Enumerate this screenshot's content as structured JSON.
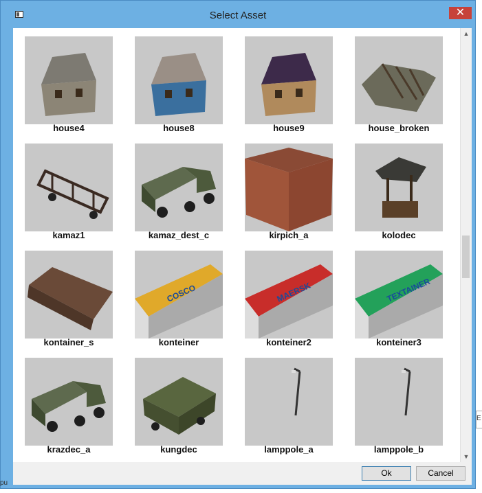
{
  "window": {
    "title": "Select Asset",
    "close_glyph": "✕"
  },
  "assets": [
    {
      "name": "house4",
      "icon": "house-icon"
    },
    {
      "name": "house8",
      "icon": "house-icon"
    },
    {
      "name": "house9",
      "icon": "house-icon"
    },
    {
      "name": "house_broken",
      "icon": "ruined-house-icon"
    },
    {
      "name": "kamaz1",
      "icon": "truck-frame-icon"
    },
    {
      "name": "kamaz_dest_c",
      "icon": "truck-icon"
    },
    {
      "name": "kirpich_a",
      "icon": "brick-cube-icon"
    },
    {
      "name": "kolodec",
      "icon": "well-icon"
    },
    {
      "name": "kontainer_s",
      "icon": "tank-container-icon"
    },
    {
      "name": "konteiner",
      "icon": "shipping-container-icon"
    },
    {
      "name": "konteiner2",
      "icon": "shipping-container-icon"
    },
    {
      "name": "konteiner3",
      "icon": "shipping-container-icon"
    },
    {
      "name": "krazdec_a",
      "icon": "truck-icon"
    },
    {
      "name": "kungdec",
      "icon": "truck-body-icon"
    },
    {
      "name": "lamppole_a",
      "icon": "lamppole-icon"
    },
    {
      "name": "lamppole_b",
      "icon": "lamppole-icon"
    }
  ],
  "container_texts": {
    "konteiner": "COSCO",
    "konteiner2": "MAERSK",
    "konteiner3": "TEXTAINER"
  },
  "buttons": {
    "ok": "Ok",
    "cancel": "Cancel"
  },
  "scrollbar": {
    "up": "▲",
    "down": "▼"
  },
  "colors": {
    "titlebar": "#6db0e3",
    "close": "#c7423a",
    "tile_bg": "#c8c8c8",
    "cosco": "#e0a92a",
    "maersk": "#c82d2a",
    "textainer": "#23a15a"
  },
  "side_glimpse": "E",
  "bottom_left_glimpse": "pu"
}
